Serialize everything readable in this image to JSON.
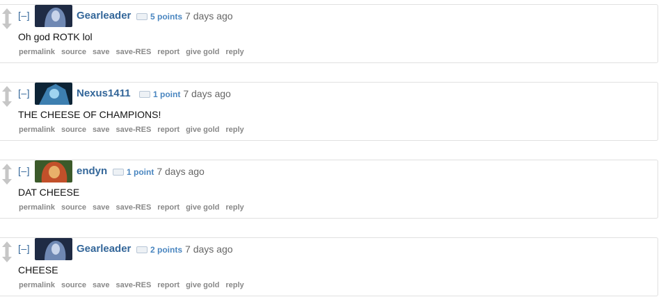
{
  "action_buttons": [
    "permalink",
    "source",
    "save",
    "save-RES",
    "report",
    "give gold",
    "reply"
  ],
  "collapse_label": "[–]",
  "comments": [
    {
      "author": "Gearleader",
      "score": "5 points",
      "time": "7 days ago",
      "body": "Oh god ROTK lol",
      "avatar": "dark-hooded-hero-avatar",
      "avatar_colors": [
        "#1f2b44",
        "#6f88b3",
        "#c8d4ea"
      ]
    },
    {
      "author": "Nexus1411",
      "score": "1 point",
      "time": "7 days ago",
      "body": "THE CHEESE OF CHAMPIONS!",
      "avatar": "blue-armored-hero-avatar",
      "avatar_colors": [
        "#0d2436",
        "#3d7fb0",
        "#9fd4f0"
      ]
    },
    {
      "author": "endyn",
      "score": "1 point",
      "time": "7 days ago",
      "body": "DAT CHEESE",
      "avatar": "red-haired-hero-avatar",
      "avatar_colors": [
        "#3c5a2a",
        "#c2502a",
        "#e8b06a"
      ]
    },
    {
      "author": "Gearleader",
      "score": "2 points",
      "time": "7 days ago",
      "body": "CHEESE",
      "avatar": "dark-hooded-hero-avatar",
      "avatar_colors": [
        "#1f2b44",
        "#6f88b3",
        "#c8d4ea"
      ]
    }
  ]
}
